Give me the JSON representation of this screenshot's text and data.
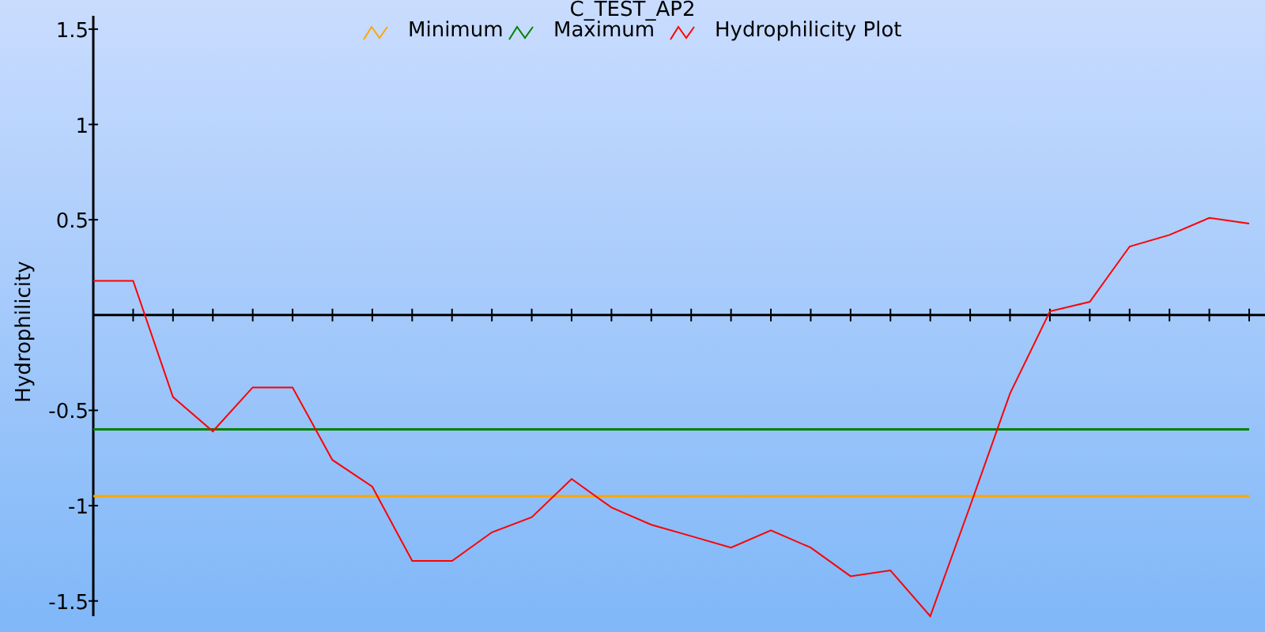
{
  "chart_data": {
    "type": "line",
    "title": "C_TEST_AP2",
    "ylabel": "Hydrophilicity",
    "categories": [
      null,
      null,
      null,
      null,
      null,
      null,
      null,
      null,
      null,
      null,
      null,
      null,
      null,
      null,
      null,
      null,
      null,
      null,
      null,
      null,
      null,
      null,
      null,
      null,
      null,
      null,
      null,
      null,
      null,
      null
    ],
    "series": [
      {
        "name": "Minimum",
        "color": "#ffa500",
        "values": [
          -0.95,
          -0.95,
          -0.95,
          -0.95,
          -0.95,
          -0.95,
          -0.95,
          -0.95,
          -0.95,
          -0.95,
          -0.95,
          -0.95,
          -0.95,
          -0.95,
          -0.95,
          -0.95,
          -0.95,
          -0.95,
          -0.95,
          -0.95,
          -0.95,
          -0.95,
          -0.95,
          -0.95,
          -0.95,
          -0.95,
          -0.95,
          -0.95,
          -0.95,
          -0.95
        ]
      },
      {
        "name": "Maximum",
        "color": "#008000",
        "values": [
          -0.6,
          -0.6,
          -0.6,
          -0.6,
          -0.6,
          -0.6,
          -0.6,
          -0.6,
          -0.6,
          -0.6,
          -0.6,
          -0.6,
          -0.6,
          -0.6,
          -0.6,
          -0.6,
          -0.6,
          -0.6,
          -0.6,
          -0.6,
          -0.6,
          -0.6,
          -0.6,
          -0.6,
          -0.6,
          -0.6,
          -0.6,
          -0.6,
          -0.6,
          -0.6
        ]
      },
      {
        "name": "Hydrophilicity Plot",
        "color": "#ff0000",
        "values": [
          0.18,
          0.18,
          -0.43,
          -0.61,
          -0.38,
          -0.38,
          -0.76,
          -0.9,
          -1.29,
          -1.29,
          -1.14,
          -1.06,
          -0.86,
          -1.01,
          -1.1,
          -1.16,
          -1.22,
          -1.13,
          -1.22,
          -1.37,
          -1.34,
          -1.58,
          -1.0,
          -0.41,
          0.02,
          0.07,
          0.36,
          0.42,
          0.51,
          0.48
        ]
      }
    ],
    "ylim": [
      -1.58,
      1.57
    ],
    "legend": true,
    "yticks": [
      {
        "value": 1.5,
        "label": "1.5"
      },
      {
        "value": 1,
        "label": "1"
      },
      {
        "value": 0.5,
        "label": "0.5"
      },
      {
        "value": -0.5,
        "label": "-0.5"
      },
      {
        "value": -1,
        "label": "-1"
      },
      {
        "value": -1.5,
        "label": "-1.5"
      }
    ]
  }
}
